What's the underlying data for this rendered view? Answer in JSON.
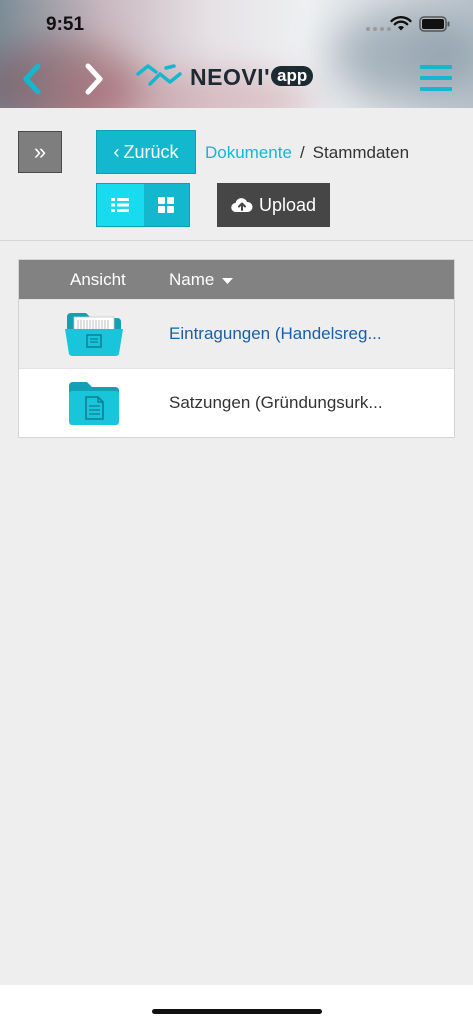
{
  "status_bar": {
    "time": "9:51"
  },
  "header": {
    "logo_text": "NEOVI'",
    "logo_badge": "app",
    "icons": [
      "chevron-left-icon",
      "chevron-right-icon",
      "hamburger-menu-icon"
    ]
  },
  "toolbar": {
    "expand_label": "»",
    "back_label": "Zurück",
    "upload_label": "Upload",
    "view_modes": [
      "list",
      "grid"
    ],
    "active_view": "list"
  },
  "breadcrumb": {
    "link": "Dokumente",
    "separator": "/",
    "current": "Stammdaten"
  },
  "table": {
    "columns": {
      "view": "Ansicht",
      "name": "Name"
    },
    "sort": "desc",
    "rows": [
      {
        "name": "Eintragungen (Handelsreg...",
        "icon": "folder-open-document-icon",
        "is_link": true
      },
      {
        "name": "Satzungen (Gründungsurk...",
        "icon": "folder-document-icon",
        "is_link": false
      }
    ]
  },
  "colors": {
    "accent": "#13b8cf",
    "accent_light": "#19dbf0",
    "dark_button": "#464646",
    "table_header": "#828282",
    "link": "#1a5fa8",
    "background": "#eeeeee"
  }
}
